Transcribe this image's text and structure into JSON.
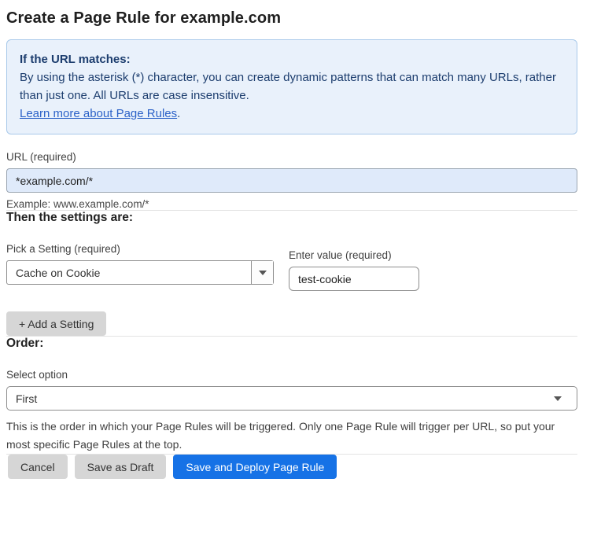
{
  "page": {
    "title": "Create a Page Rule for example.com"
  },
  "info_box": {
    "heading": "If the URL matches:",
    "body": "By using the asterisk (*) character, you can create dynamic patterns that can match many URLs, rather than just one. All URLs are case insensitive.",
    "link_label": "Learn more about Page Rules",
    "link_suffix": "."
  },
  "url_field": {
    "label": "URL (required)",
    "value": "*example.com/*",
    "helper": "Example: www.example.com/*"
  },
  "settings_section": {
    "heading": "Then the settings are:",
    "setting_select": {
      "label": "Pick a Setting (required)",
      "value": "Cache on Cookie"
    },
    "value_field": {
      "label": "Enter value (required)",
      "value": "test-cookie"
    },
    "add_setting_label": "+ Add a Setting"
  },
  "order_section": {
    "heading": "Order:",
    "select_label": "Select option",
    "selected_option": "First",
    "helper": "This is the order in which your Page Rules will be triggered. Only one Page Rule will trigger per URL, so put your most specific Page Rules at the top."
  },
  "footer": {
    "cancel_label": "Cancel",
    "save_draft_label": "Save as Draft",
    "save_deploy_label": "Save and Deploy Page Rule"
  },
  "colors": {
    "info_bg": "#e9f1fb",
    "info_border": "#a9c9ea",
    "info_text": "#1c3d6e",
    "link": "#2c62c8",
    "url_input_bg": "#dfeafa",
    "primary_button": "#1672e6",
    "secondary_button": "#d6d6d6"
  },
  "icons": {
    "dropdown_arrow": "caret-down"
  }
}
